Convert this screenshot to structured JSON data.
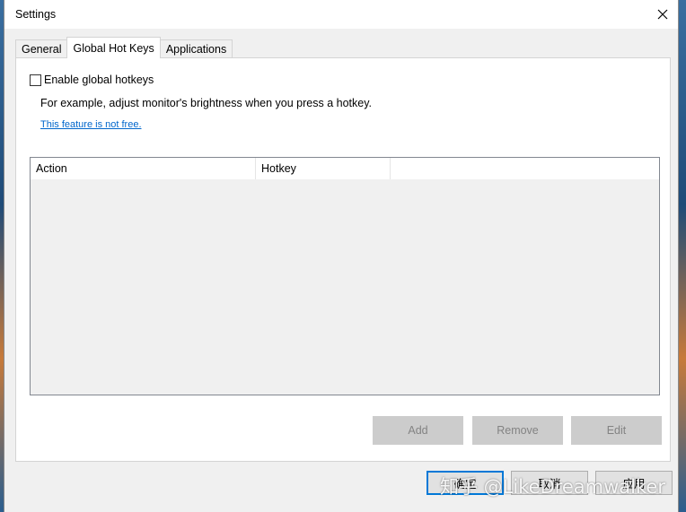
{
  "window": {
    "title": "Settings"
  },
  "tabs": [
    {
      "label": "General"
    },
    {
      "label": "Global Hot Keys"
    },
    {
      "label": "Applications"
    }
  ],
  "hotkeys": {
    "enable_label": "Enable global hotkeys",
    "enabled": false,
    "description": "For example, adjust monitor's brightness when you press a hotkey.",
    "link": "This feature is not free.",
    "columns": [
      "Action",
      "Hotkey",
      ""
    ],
    "rows": []
  },
  "actions": {
    "add": "Add",
    "remove": "Remove",
    "edit": "Edit"
  },
  "footer": {
    "ok": "确定",
    "cancel": "取消",
    "apply": "应用"
  },
  "watermark": "知乎 @LikeDreamwalker",
  "colors": {
    "link": "#0066cc",
    "focus_border": "#0078d7",
    "disabled_button": "#cccccc"
  }
}
